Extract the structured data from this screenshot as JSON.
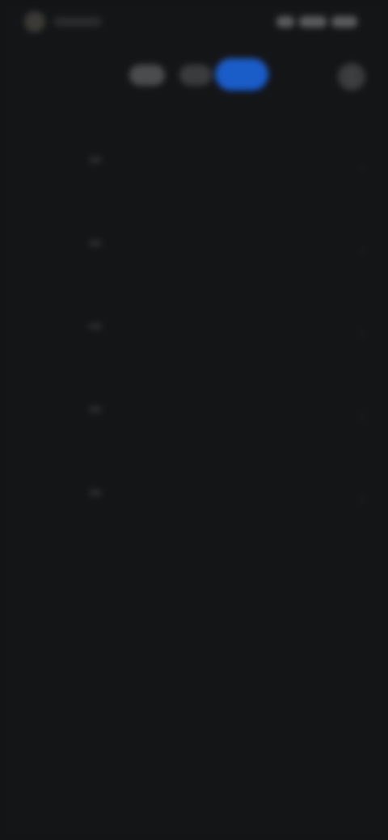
{
  "status_bar": {
    "left_icon": "app-icon",
    "left_text": "",
    "right_text": ""
  },
  "top_row": {
    "tabs": [
      {
        "label": "",
        "state": "inactive"
      },
      {
        "label": "",
        "state": "inactive"
      },
      {
        "label": "",
        "state": "active"
      }
    ],
    "right_icon": "more-icon",
    "colors": {
      "accent": "#1a5cc8",
      "background": "#141517"
    }
  },
  "list": {
    "items": [
      {
        "label": ""
      },
      {
        "label": ""
      },
      {
        "label": ""
      },
      {
        "label": ""
      },
      {
        "label": ""
      }
    ]
  }
}
